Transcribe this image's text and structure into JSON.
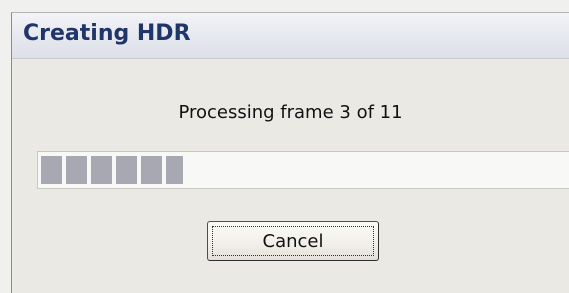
{
  "window": {
    "title": "Creating HDR"
  },
  "status": {
    "message": "Processing frame 3 of 11"
  },
  "progress": {
    "fraction": 0.27
  },
  "buttons": {
    "cancel_label": "Cancel"
  }
}
